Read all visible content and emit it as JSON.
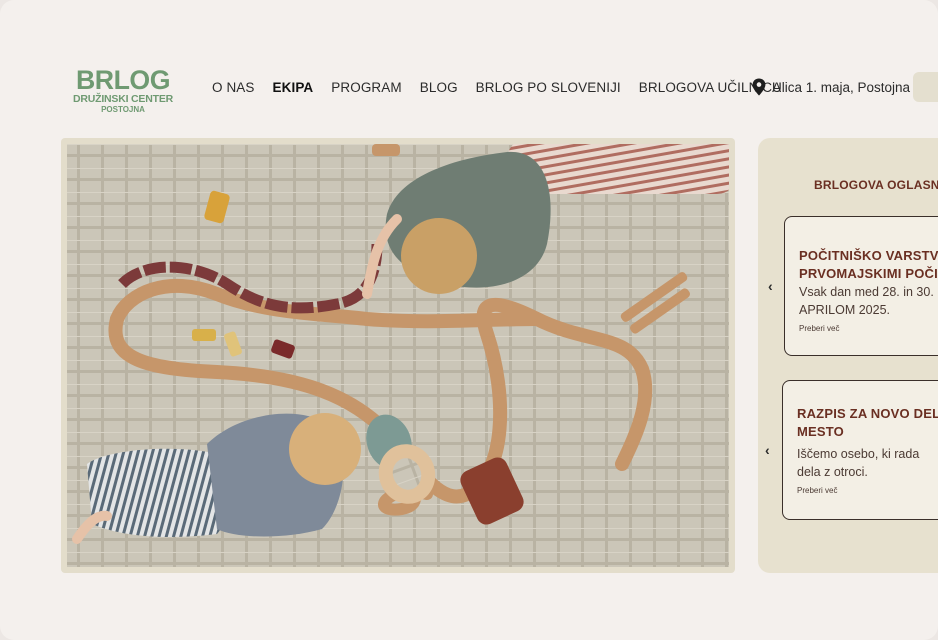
{
  "logo": {
    "line1": "BRLOG",
    "line2": "DRUŽINSKI CENTER",
    "line3": "POSTOJNA"
  },
  "nav": {
    "items": [
      {
        "label": "O NAS",
        "active": false
      },
      {
        "label": "EKIPA",
        "active": true
      },
      {
        "label": "PROGRAM",
        "active": false
      },
      {
        "label": "BLOG",
        "active": false
      },
      {
        "label": "BRLOG PO SLOVENIJI",
        "active": false
      },
      {
        "label": "BRLOGOVA UČILNICA",
        "active": false
      }
    ]
  },
  "address": {
    "icon": "map-pin-icon",
    "text": "Ulica 1. maja, Postojna"
  },
  "hero": {
    "image": "children-playing-with-wooden-train-tracks-photo"
  },
  "board": {
    "title": "BRLOGOVA OGLASNA",
    "cards": [
      {
        "title_line1": "POČITNIŠKO VARSTVO",
        "title_line2": "PRVOMAJSKIMI POČIT",
        "text_line1": "Vsak dan med 28. in 30.",
        "text_line2": "APRILOM 2025.",
        "more": "Preberi več"
      },
      {
        "title_line1": "RAZPIS ZA NOVO DELO",
        "title_line2": "MESTO",
        "text_line1": "Iščemo osebo, ki rada",
        "text_line2": "dela z otroci.",
        "more": "Preberi več"
      }
    ],
    "arrow": "‹"
  },
  "colors": {
    "background": "#f4f0ed",
    "logo_green": "#6f9a72",
    "board_bg": "#e7e1cf",
    "accent_brown": "#6a2f22"
  }
}
